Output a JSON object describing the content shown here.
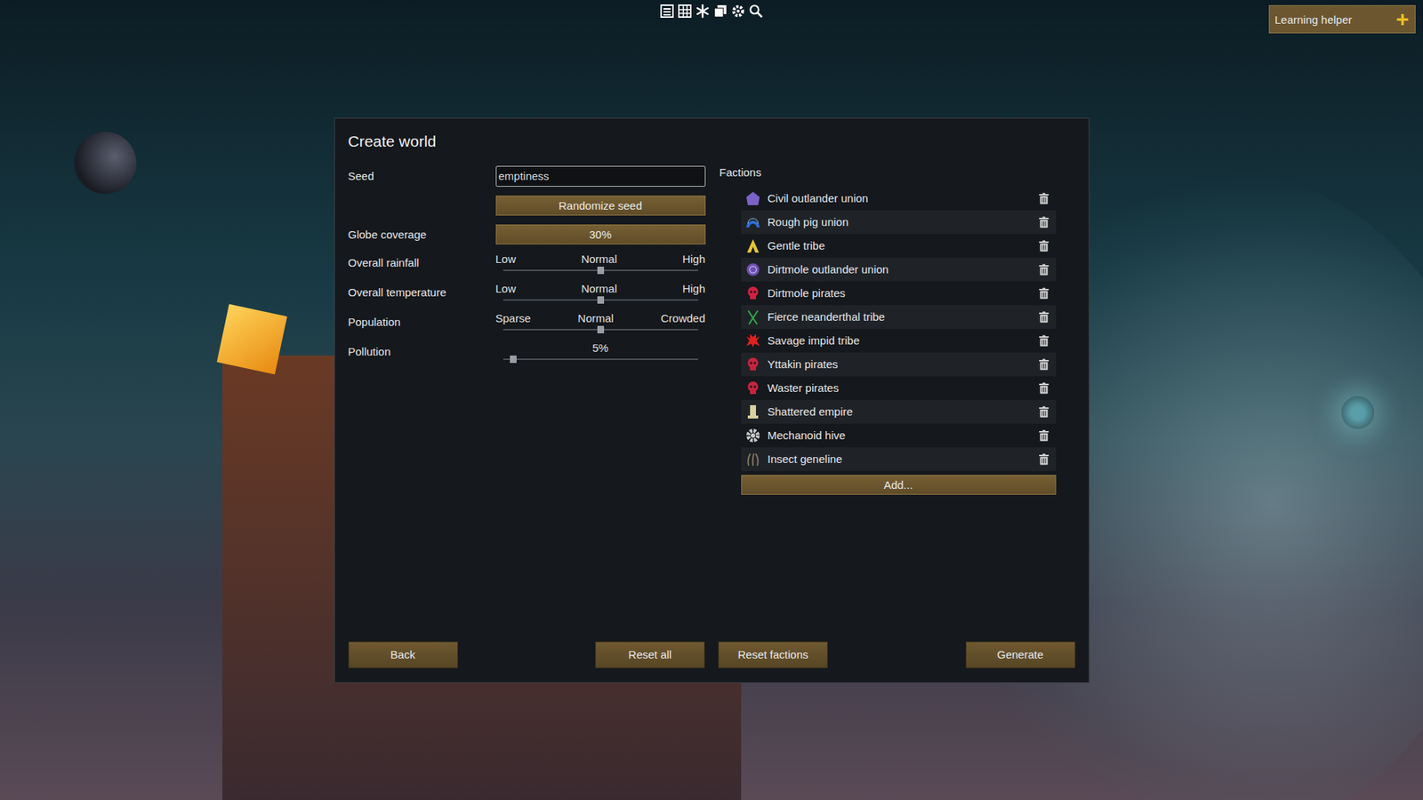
{
  "window": {
    "title": "Create world"
  },
  "learning_helper": {
    "label": "Learning helper",
    "icon": "+"
  },
  "seed": {
    "label": "Seed",
    "value": "emptiness"
  },
  "randomize_button": {
    "label": "Randomize seed"
  },
  "globe_coverage": {
    "label": "Globe coverage",
    "value": "30%"
  },
  "sliders": [
    {
      "label": "Overall rainfall",
      "kind": "marks",
      "marks": [
        "Low",
        "Normal",
        "High"
      ],
      "level": 0.5
    },
    {
      "label": "Overall temperature",
      "kind": "marks",
      "marks": [
        "Low",
        "Normal",
        "High"
      ],
      "level": 0.5
    },
    {
      "label": "Population",
      "kind": "marks",
      "marks": [
        "Sparse",
        "Normal",
        "Crowded"
      ],
      "level": 0.5
    },
    {
      "label": "Pollution",
      "kind": "reading",
      "reading": "5%",
      "level": 0.05
    }
  ],
  "factions": {
    "label": "Factions",
    "add_button": "Add...",
    "items": [
      {
        "name": "Civil outlander union",
        "kind": "house",
        "color": "#7a62c8"
      },
      {
        "name": "Rough pig union",
        "kind": "dome",
        "color": "#2f6fd8"
      },
      {
        "name": "Gentle tribe",
        "kind": "tent",
        "color": "#e6c53a"
      },
      {
        "name": "Dirtmole outlander union",
        "kind": "badge",
        "color": "#6c4fb0"
      },
      {
        "name": "Dirtmole pirates",
        "kind": "skull",
        "color": "#d0213f"
      },
      {
        "name": "Fierce neanderthal tribe",
        "kind": "spear",
        "color": "#2fa84a"
      },
      {
        "name": "Savage impid tribe",
        "kind": "star",
        "color": "#e02020"
      },
      {
        "name": "Yttakin pirates",
        "kind": "skull",
        "color": "#c8243f"
      },
      {
        "name": "Waster pirates",
        "kind": "skull",
        "color": "#c8243f"
      },
      {
        "name": "Shattered empire",
        "kind": "pillar",
        "color": "#d8d0a0"
      },
      {
        "name": "Mechanoid hive",
        "kind": "gear",
        "color": "#c8c8c8"
      },
      {
        "name": "Insect geneline",
        "kind": "claws",
        "color": "#8a7a60"
      }
    ]
  },
  "buttons": [
    {
      "label": "Back"
    },
    {
      "label": "Reset all"
    },
    {
      "label": "Reset factions"
    },
    {
      "label": "Generate"
    }
  ]
}
